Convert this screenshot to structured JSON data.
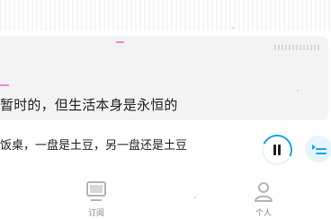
{
  "content": {
    "card_title": "暂时的，但生活本身是永恒的"
  },
  "player": {
    "now_playing_text": "饭桌，一盘是土豆，另一盘还是土豆",
    "progress_fraction": 0.3,
    "state": "playing"
  },
  "tabbar": {
    "items": [
      {
        "label": "订阅",
        "icon": "tv-icon"
      },
      {
        "label": "个人",
        "icon": "person-icon"
      }
    ]
  },
  "colors": {
    "accent": "#1aa5e6",
    "accent_light": "#e6f4fb",
    "card_bg": "#f3f3f3",
    "text": "#222222",
    "tab_text": "#888888"
  }
}
